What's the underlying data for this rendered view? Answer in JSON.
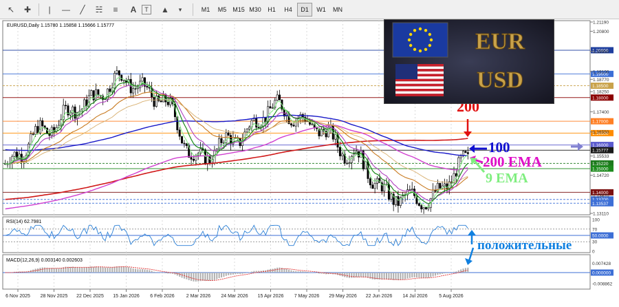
{
  "toolbar": {
    "icons": [
      "cursor-icon",
      "crosshair-icon",
      "horizontal-line-icon",
      "trendline-icon",
      "channel-icon",
      "text-tool-icon",
      "label-tool-icon",
      "shapes-icon"
    ],
    "timeframes": [
      "M1",
      "M5",
      "M15",
      "M30",
      "H1",
      "H4",
      "D1",
      "W1",
      "MN"
    ],
    "active_timeframe": "D1"
  },
  "main": {
    "info": "EURUSD,Daily  1.15780 1.15858 1.15666 1.15777",
    "annotations": {
      "ma200": "200",
      "ma100": "100",
      "ema200": "200 EMA",
      "ema9": "9 EMA",
      "positive": "положительные"
    },
    "price_ticks": [
      "1.21190",
      "1.20800",
      "1.19950",
      "1.19100",
      "1.18770",
      "1.18250",
      "1.17400",
      "1.16550",
      "1.15533",
      "1.14720",
      "1.13870",
      "1.13110"
    ],
    "levels": [
      {
        "label": "1.20000",
        "color": "#1f3f9e"
      },
      {
        "label": "1.19000",
        "color": "#3d6fd6"
      },
      {
        "label": "1.18500",
        "color": "#c9a24a"
      },
      {
        "label": "1.18000",
        "color": "#8b0000"
      },
      {
        "label": "1.17000",
        "color": "#ff7f24"
      },
      {
        "label": "1.16500",
        "color": "#ff8c00"
      },
      {
        "label": "1.16000",
        "color": "#5b5bcf"
      },
      {
        "label": "1.15777",
        "color": "#1a1a1a"
      },
      {
        "label": "1.15220",
        "color": "#1d7a1d"
      },
      {
        "label": "1.15000",
        "color": "#1d8a1d"
      },
      {
        "label": "1.14000",
        "color": "#7b1010"
      },
      {
        "label": "1.13700",
        "color": "#3d6fd6"
      },
      {
        "label": "1.13537",
        "color": "#3d6fd6"
      }
    ]
  },
  "rsi": {
    "label": "RSI(14) 62.7981",
    "ticks": [
      "100",
      "70",
      "50.0000",
      "30",
      "0"
    ]
  },
  "macd": {
    "label": "MACD(12,26,9) 0.003140 0.002603",
    "ticks": [
      "0.007428",
      "0.000000",
      "-0.008862"
    ]
  },
  "dates": [
    "6 Nov 2025",
    "28 Nov 2025",
    "22 Dec 2025",
    "15 Jan 2026",
    "6 Feb 2026",
    "2 Mar 2026",
    "24 Mar 2026",
    "15 Apr 2026",
    "7 May 2026",
    "29 May 2026",
    "22 Jun 2026",
    "14 Jul 2026",
    "5 Aug 2026"
  ],
  "banner": {
    "text_top": "EUR",
    "text_bottom": "USD"
  },
  "chart_data": {
    "type": "line",
    "title": "EURUSD,Daily",
    "x": [
      "6 Nov 2025",
      "28 Nov 2025",
      "22 Dec 2025",
      "15 Jan 2026",
      "6 Feb 2026",
      "2 Mar 2026",
      "24 Mar 2026",
      "15 Apr 2026",
      "7 May 2026",
      "29 May 2026",
      "22 Jun 2026",
      "14 Jul 2026",
      "5 Aug 2026"
    ],
    "ylim": [
      1.131,
      1.2119
    ],
    "series": [
      {
        "name": "",
        "values": [
          1.152,
          1.166,
          1.177,
          1.188,
          1.18,
          1.154,
          1.163,
          1.176,
          1.168,
          1.156,
          1.138,
          1.137,
          1.153
        ]
      }
    ],
    "current": 1.15777
  }
}
